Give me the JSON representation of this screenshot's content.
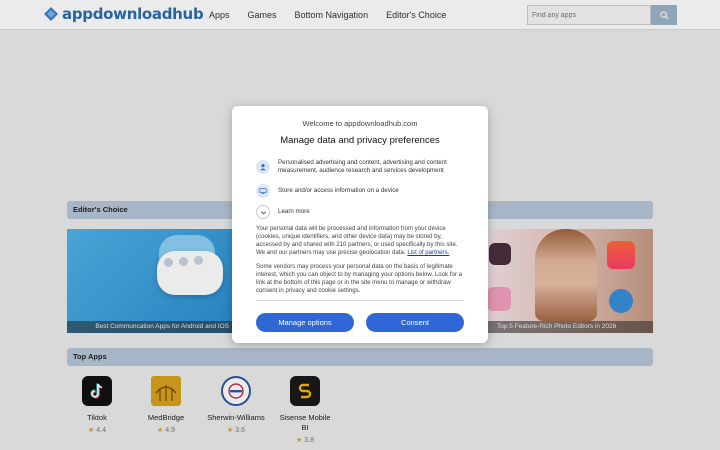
{
  "header": {
    "logo_text": "appdownloadhub",
    "nav": [
      "Apps",
      "Games",
      "Bottom Navigation",
      "Editor's Choice"
    ],
    "search_placeholder": "Find any apps"
  },
  "editors_choice": {
    "title": "Editor's Choice",
    "banners": [
      {
        "caption": "Best Communcation Apps for Android and IOS"
      },
      {
        "caption": "Top 5 Feature-Rich Photo Editors in 2026"
      }
    ]
  },
  "top_apps": {
    "title": "Top Apps",
    "apps": [
      {
        "name": "Tiktok",
        "rating": "4.4"
      },
      {
        "name": "MedBridge",
        "rating": "4.9"
      },
      {
        "name": "Sherwin-Williams",
        "rating": "3.6"
      },
      {
        "name": "Sisense Mobile BI",
        "rating": "3.8"
      }
    ]
  },
  "consent": {
    "welcome": "Welcome to appdownloadhub.com",
    "title": "Manage data and privacy preferences",
    "purpose_1": "Personalised advertising and content, advertising and content measurement, audience research and services development",
    "purpose_2": "Store and/or access information on a device",
    "learn_more": "Learn more",
    "paragraph_1": "Your personal data will be processed and information from your device (cookies, unique identifiers, and other device data) may be stored by, accessed by and shared with 210 partners, or used specifically by this site. We and our partners may use precise geolocation data.",
    "partners_link": "List of partners.",
    "paragraph_2": "Some vendors may process your personal data on the basis of legitimate interest, which you can object to by managing your options below. Look for a link at the bottom of this page or in the site menu to manage or withdraw consent in privacy and cookie settings.",
    "manage_button": "Manage options",
    "consent_button": "Consent"
  },
  "colors": {
    "accent": "#2f67d6",
    "brand": "#2a6db2",
    "section_bar": "#b7c7d8",
    "star": "#e0a020"
  }
}
